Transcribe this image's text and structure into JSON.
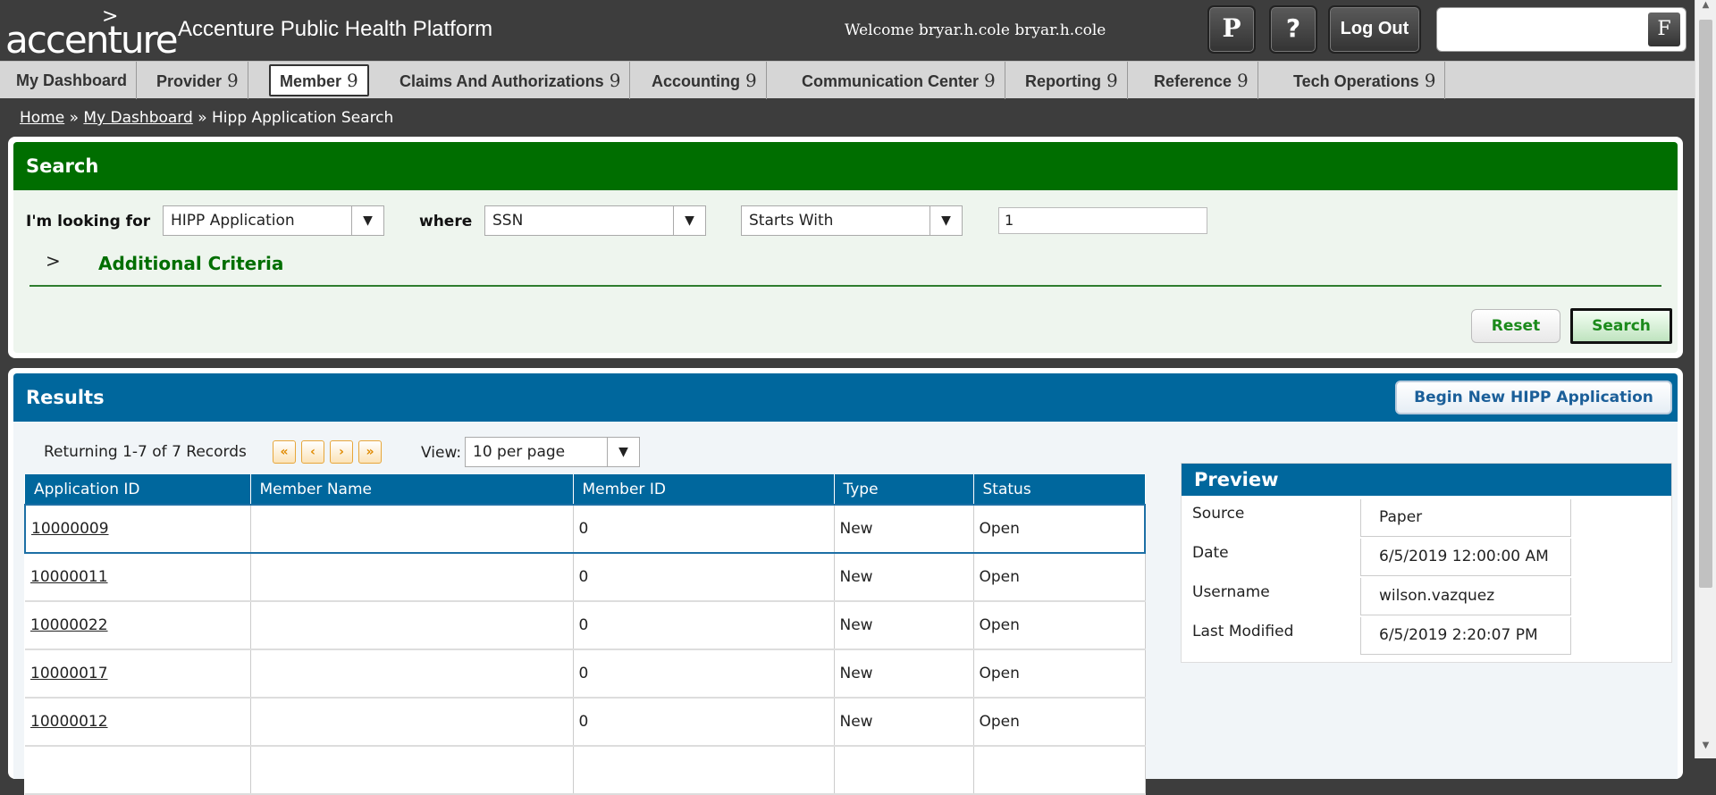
{
  "header": {
    "logo_text": "accenture",
    "logo_caret": ">",
    "title": "Accenture Public Health Platform",
    "welcome": "Welcome bryar.h.cole bryar.h.cole",
    "p_button": "P",
    "help_button": "?",
    "logout_button": "Log Out",
    "search_button": "F"
  },
  "nav": {
    "items": [
      {
        "label": "My Dashboard",
        "badge": ""
      },
      {
        "label": "Provider",
        "badge": "9"
      },
      {
        "label": "Member",
        "badge": "9"
      },
      {
        "label": "Claims And Authorizations",
        "badge": "9"
      },
      {
        "label": "Accounting",
        "badge": "9"
      },
      {
        "label": "Communication Center",
        "badge": "9"
      },
      {
        "label": "Reporting",
        "badge": "9"
      },
      {
        "label": "Reference",
        "badge": "9"
      },
      {
        "label": "Tech Operations",
        "badge": "9"
      }
    ],
    "active": "Member"
  },
  "breadcrumb": {
    "home": "Home",
    "sep": "»",
    "dashboard": "My Dashboard",
    "current": "Hipp Application Search"
  },
  "search": {
    "title": "Search",
    "looking_for_label": "I'm looking for",
    "looking_for_value": "HIPP Application",
    "where_label": "where",
    "field_value": "SSN",
    "operator_value": "Starts With",
    "query_value": "1",
    "additional_criteria": "Additional Criteria",
    "additional_arrow": ">",
    "reset_button": "Reset",
    "search_button": "Search"
  },
  "results": {
    "title": "Results",
    "begin_button": "Begin New HIPP Application",
    "returning": "Returning 1-7 of 7 Records",
    "view_label": "View:",
    "per_page": "10 per page",
    "pager": {
      "first": "«",
      "prev": "‹",
      "next": "›",
      "last": "»"
    },
    "columns": [
      "Application ID",
      "Member Name",
      "Member ID",
      "Type",
      "Status"
    ],
    "rows": [
      {
        "id": "10000009",
        "name": "",
        "member_id": "0",
        "type": "New",
        "status": "Open"
      },
      {
        "id": "10000011",
        "name": "",
        "member_id": "0",
        "type": "New",
        "status": "Open"
      },
      {
        "id": "10000022",
        "name": "",
        "member_id": "0",
        "type": "New",
        "status": "Open"
      },
      {
        "id": "10000017",
        "name": "",
        "member_id": "0",
        "type": "New",
        "status": "Open"
      },
      {
        "id": "10000012",
        "name": "",
        "member_id": "0",
        "type": "New",
        "status": "Open"
      }
    ]
  },
  "preview": {
    "title": "Preview",
    "fields": [
      {
        "label": "Source",
        "value": "Paper"
      },
      {
        "label": "Date",
        "value": "6/5/2019 12:00:00 AM"
      },
      {
        "label": "Username",
        "value": "wilson.vazquez"
      },
      {
        "label": "Last Modified",
        "value": "6/5/2019 2:20:07 PM"
      }
    ]
  },
  "colors": {
    "search_header": "#006e00",
    "results_header": "#00679d",
    "background": "#3d3d3d",
    "pager_accent": "#e08a00"
  }
}
